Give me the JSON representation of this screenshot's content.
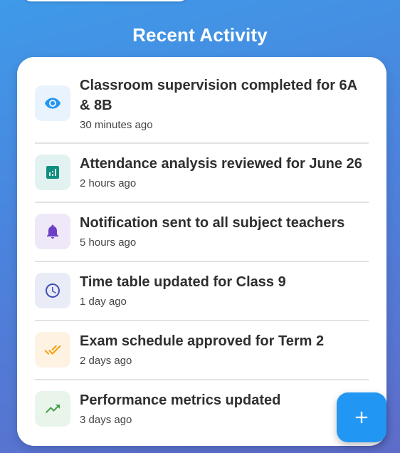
{
  "section": {
    "title": "Recent Activity"
  },
  "activities": [
    {
      "title": "Classroom supervision completed for 6A & 8B",
      "time": "30 minutes ago",
      "icon": "eye-icon",
      "icon_color": "#2196f3",
      "icon_bg": "#e8f3fd"
    },
    {
      "title": "Attendance analysis reviewed for June 26",
      "time": "2 hours ago",
      "icon": "analytics-icon",
      "icon_color": "#0f8f80",
      "icon_bg": "#e2f2f0"
    },
    {
      "title": "Notification sent to all subject teachers",
      "time": "5 hours ago",
      "icon": "bell-icon",
      "icon_color": "#6d3fc8",
      "icon_bg": "#efe8f8"
    },
    {
      "title": "Time table updated for Class 9",
      "time": "1 day ago",
      "icon": "clock-icon",
      "icon_color": "#3f51b5",
      "icon_bg": "#e9ebf6"
    },
    {
      "title": "Exam schedule approved for Term 2",
      "time": "2 days ago",
      "icon": "double-check-icon",
      "icon_color": "#f59e0b",
      "icon_bg": "#fef3e3"
    },
    {
      "title": "Performance metrics updated",
      "time": "3 days ago",
      "icon": "trending-up-icon",
      "icon_color": "#43a047",
      "icon_bg": "#e9f5ea"
    }
  ],
  "fab": {
    "icon": "plus-icon",
    "color": "#2196f3"
  }
}
